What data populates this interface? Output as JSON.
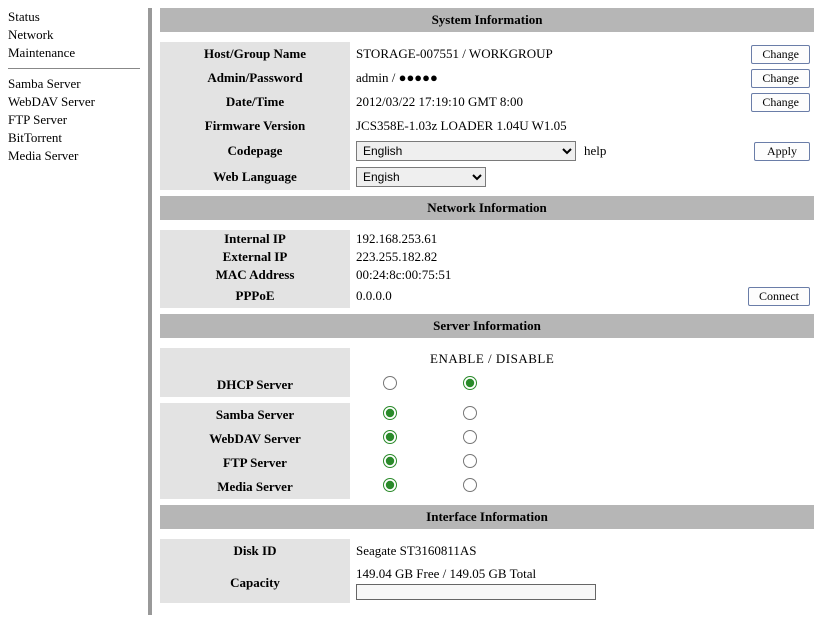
{
  "sidebar": {
    "group1": [
      {
        "label": "Status"
      },
      {
        "label": "Network"
      },
      {
        "label": "Maintenance"
      }
    ],
    "group2": [
      {
        "label": "Samba Server"
      },
      {
        "label": "WebDAV Server"
      },
      {
        "label": "FTP Server"
      },
      {
        "label": "BitTorrent"
      },
      {
        "label": "Media Server"
      }
    ]
  },
  "sections": {
    "system": "System Information",
    "network": "Network Information",
    "server": "Server Information",
    "interface": "Interface Information"
  },
  "system": {
    "host_label": "Host/Group Name",
    "host_value": "STORAGE-007551 / WORKGROUP",
    "admin_label": "Admin/Password",
    "admin_value": "admin / ●●●●●",
    "date_label": "Date/Time",
    "date_value": "2012/03/22 17:19:10 GMT 8:00",
    "fw_label": "Firmware Version",
    "fw_value": "JCS358E-1.03z LOADER 1.04U W1.05",
    "codepage_label": "Codepage",
    "codepage_value": "English",
    "codepage_help": "help",
    "weblang_label": "Web Language",
    "weblang_value": "Engish"
  },
  "buttons": {
    "change": "Change",
    "apply": "Apply",
    "connect": "Connect"
  },
  "network": {
    "internal_label": "Internal IP",
    "internal_value": "192.168.253.61",
    "external_label": "External IP",
    "external_value": "223.255.182.82",
    "mac_label": "MAC Address",
    "mac_value": "00:24:8c:00:75:51",
    "pppoe_label": "PPPoE",
    "pppoe_value": "0.0.0.0"
  },
  "server": {
    "enable_header": "ENABLE  /  DISABLE",
    "dhcp_label": "DHCP Server",
    "samba_label": "Samba Server",
    "webdav_label": "WebDAV Server",
    "ftp_label": "FTP Server",
    "media_label": "Media Server"
  },
  "interface": {
    "disk_label": "Disk ID",
    "disk_value": "Seagate ST3160811AS",
    "capacity_label": "Capacity",
    "capacity_value": "149.04 GB Free / 149.05 GB Total"
  }
}
